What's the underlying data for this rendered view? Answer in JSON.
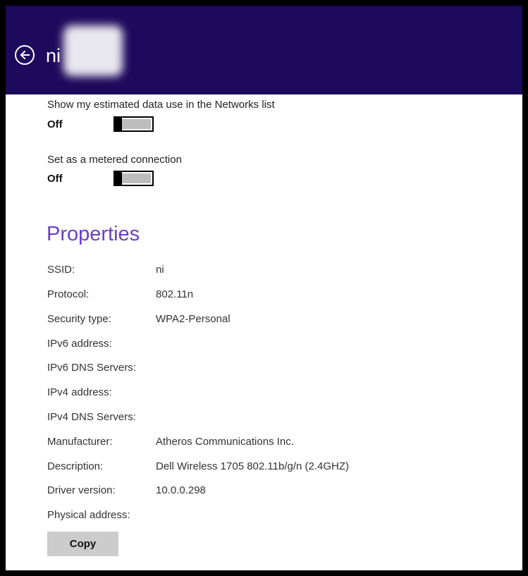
{
  "header": {
    "title": "ni",
    "background": "#1e0a5c",
    "back_icon": "back-arrow-circle-icon"
  },
  "settings": [
    {
      "label": "Show my estimated data use in the Networks list",
      "state": "Off",
      "on": false
    },
    {
      "label": "Set as a metered connection",
      "state": "Off",
      "on": false
    }
  ],
  "properties": {
    "title": "Properties",
    "title_color": "#6a3fc4",
    "rows": [
      {
        "key": "SSID:",
        "value": "ni"
      },
      {
        "key": "Protocol:",
        "value": "802.11n"
      },
      {
        "key": "Security type:",
        "value": "WPA2-Personal"
      },
      {
        "key": "IPv6 address:",
        "value": ""
      },
      {
        "key": "IPv6 DNS Servers:",
        "value": ""
      },
      {
        "key": "IPv4 address:",
        "value": ""
      },
      {
        "key": "IPv4 DNS Servers:",
        "value": ""
      },
      {
        "key": "Manufacturer:",
        "value": "Atheros Communications Inc."
      },
      {
        "key": "Description:",
        "value": "Dell Wireless 1705 802.11b/g/n (2.4GHZ)"
      },
      {
        "key": "Driver version:",
        "value": "10.0.0.298"
      },
      {
        "key": "Physical address:",
        "value": ""
      }
    ]
  },
  "copy_button": {
    "label": "Copy"
  }
}
